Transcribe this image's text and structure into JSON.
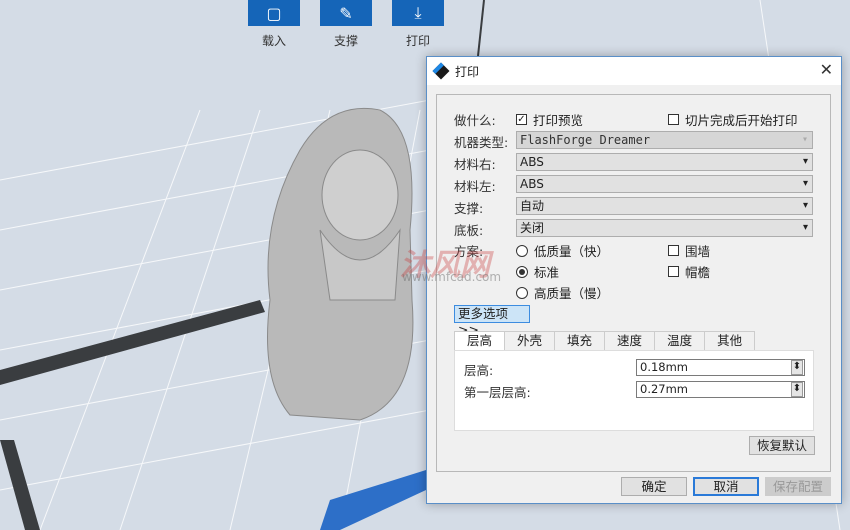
{
  "toolbar": {
    "load": "载入",
    "support": "支撑",
    "print": "打印"
  },
  "dialog": {
    "title": "打印",
    "what_label": "做什么:",
    "print_preview": "打印预览",
    "print_after_slice": "切片完成后开始打印",
    "machine_label": "机器类型:",
    "machine_value": "FlashForge Dreamer",
    "mat_right_label": "材料右:",
    "mat_right_value": "ABS",
    "mat_left_label": "材料左:",
    "mat_left_value": "ABS",
    "support_label": "支撑:",
    "support_value": "自动",
    "raft_label": "底板:",
    "raft_value": "关闭",
    "scheme_label": "方案:",
    "quality_low": "低质量（快）",
    "quality_std": "标准",
    "quality_high": "高质量（慢）",
    "wall": "围墙",
    "brim": "帽檐",
    "more_options": "更多选项 >>",
    "tabs": [
      "层高",
      "外壳",
      "填充",
      "速度",
      "温度",
      "其他"
    ],
    "layer_height_label": "层高:",
    "layer_height_value": "0.18mm",
    "first_layer_label": "第一层层高:",
    "first_layer_value": "0.27mm",
    "restore_default": "恢复默认",
    "ok": "确定",
    "cancel": "取消",
    "save_config": "保存配置"
  },
  "watermark": {
    "brand": "沐风网",
    "site": "www.mfcad.com"
  }
}
